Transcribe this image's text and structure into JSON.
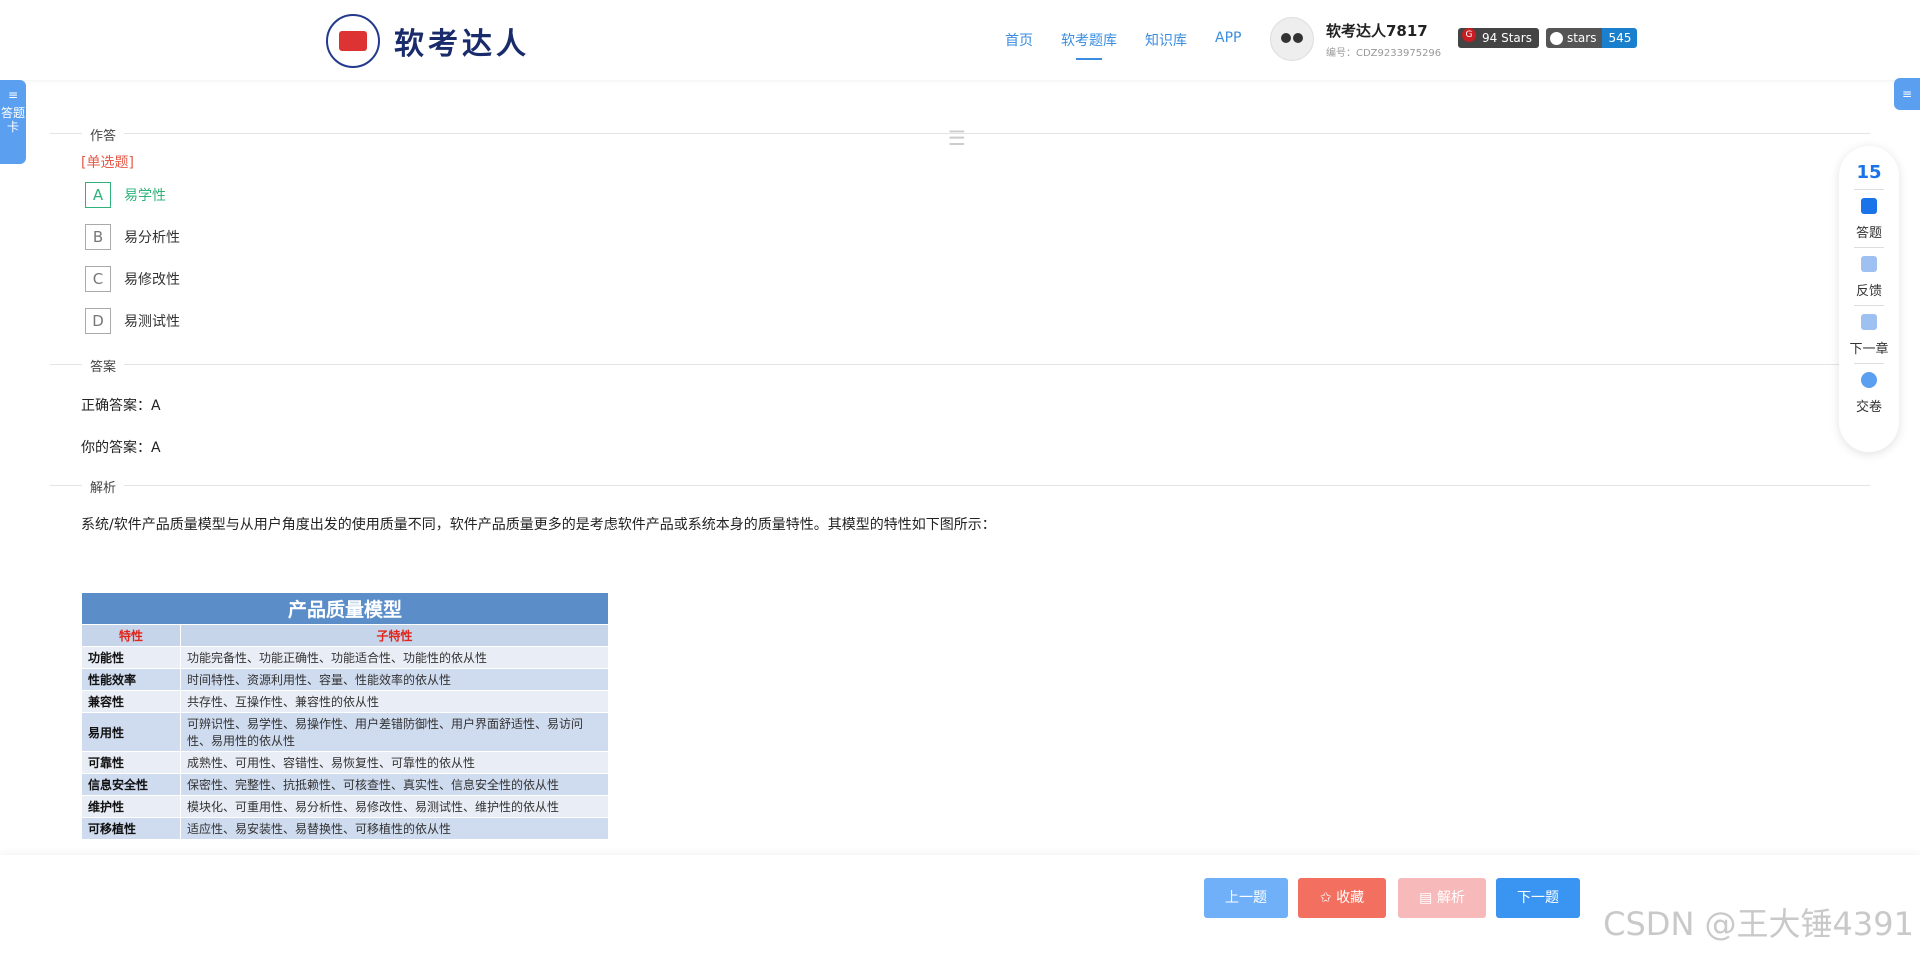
{
  "header": {
    "logo_text": "软考达人",
    "nav": [
      "首页",
      "软考题库",
      "知识库",
      "APP"
    ],
    "active_nav_index": 1,
    "user_name": "软考达人7817",
    "user_id": "编号：CDZ9233975296",
    "gitee_badge": "94 Stars",
    "github_left": "stars",
    "github_right": "545"
  },
  "side": {
    "left_tab": "答题卡",
    "left_icon": "≡",
    "right_icon": "≡"
  },
  "question": {
    "section_answer_label": "作答",
    "type_label": "[单选题]",
    "options": [
      {
        "letter": "A",
        "text": "易学性",
        "selected": true
      },
      {
        "letter": "B",
        "text": "易分析性",
        "selected": false
      },
      {
        "letter": "C",
        "text": "易修改性",
        "selected": false
      },
      {
        "letter": "D",
        "text": "易测试性",
        "selected": false
      }
    ]
  },
  "answer": {
    "section_label": "答案",
    "correct": "正确答案：A",
    "yours": "你的答案：A"
  },
  "analysis": {
    "section_label": "解析",
    "text": "系统/软件产品质量模型与从用户角度出发的使用质量不同，软件产品质量更多的是考虑软件产品或系统本身的质量特性。其模型的特性如下图所示：",
    "table_title": "产品质量模型",
    "col_headers": [
      "特性",
      "子特性"
    ],
    "rows": [
      [
        "功能性",
        "功能完备性、功能正确性、功能适合性、功能性的依从性"
      ],
      [
        "性能效率",
        "时间特性、资源利用性、容量、性能效率的依从性"
      ],
      [
        "兼容性",
        "共存性、互操作性、兼容性的依从性"
      ],
      [
        "易用性",
        "可辨识性、易学性、易操作性、用户差错防御性、用户界面舒适性、易访问性、易用性的依从性"
      ],
      [
        "可靠性",
        "成熟性、可用性、容错性、易恢复性、可靠性的依从性"
      ],
      [
        "信息安全性",
        "保密性、完整性、抗抵赖性、可核查性、真实性、信息安全性的依从性"
      ],
      [
        "维护性",
        "模块化、可重用性、易分析性、易修改性、易测试性、维护性的依从性"
      ],
      [
        "可移植性",
        "适应性、易安装性、易替换性、可移植性的依从性"
      ]
    ]
  },
  "float_panel": {
    "count": "15",
    "items": [
      "答题",
      "反馈",
      "下一章",
      "交卷"
    ]
  },
  "footer": {
    "prev": "上一题",
    "fav": "✩ 收藏",
    "analysis": "▤ 解析",
    "next": "下一题",
    "watermark": "CSDN @王大锤4391"
  }
}
